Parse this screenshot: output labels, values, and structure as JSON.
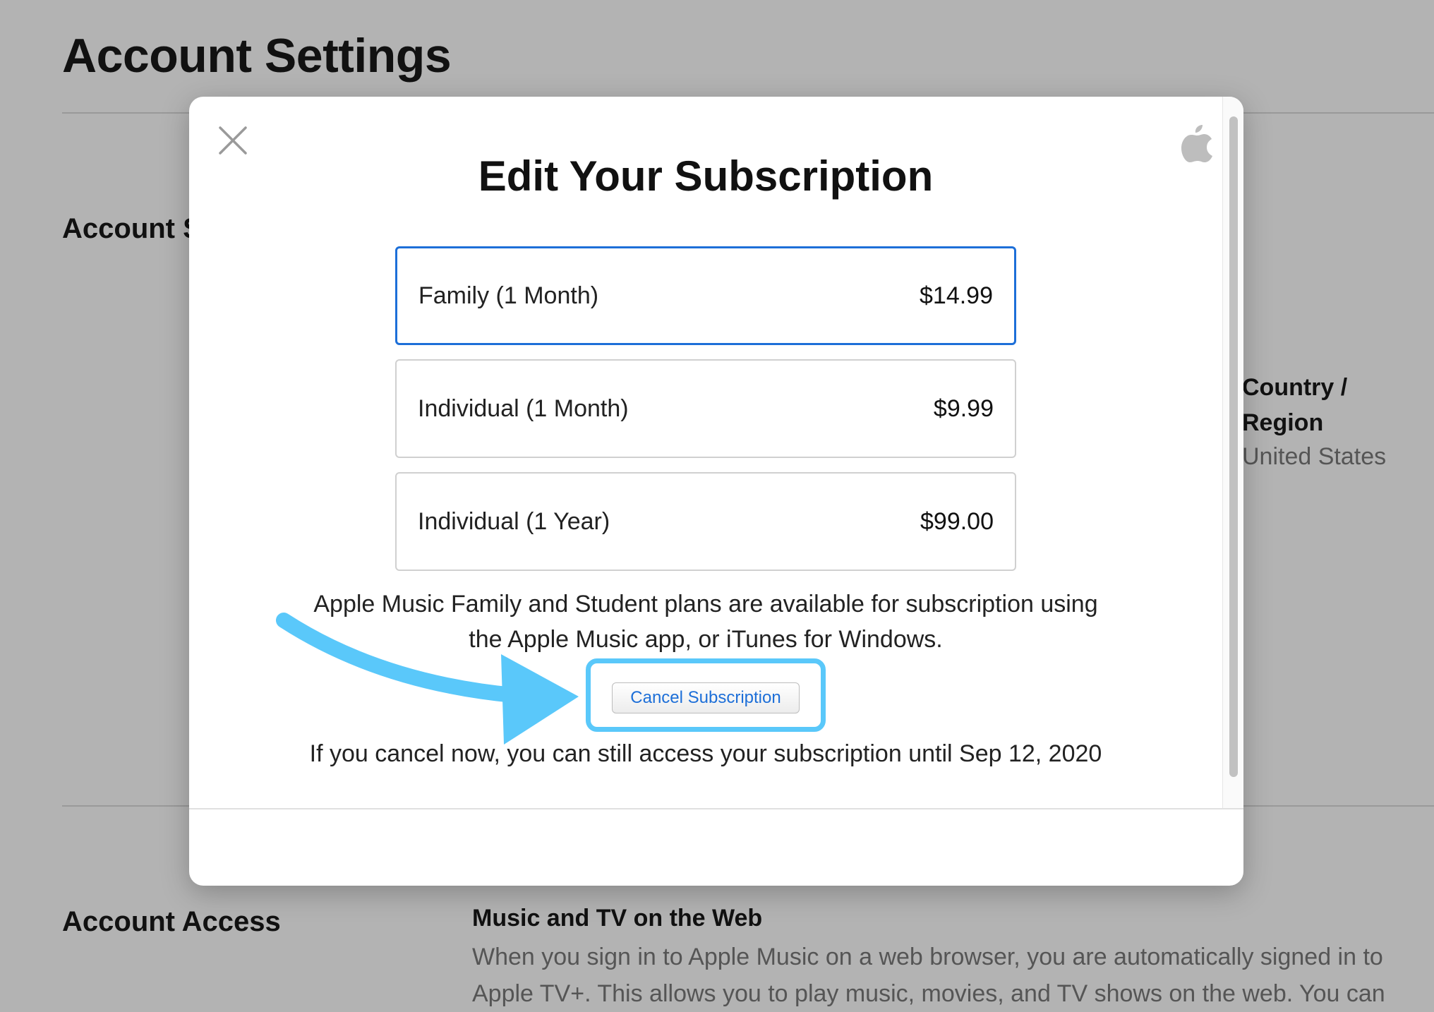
{
  "background": {
    "page_title": "Account Settings",
    "account_summary_label": "Account S",
    "country_region_label": "Country / Region",
    "country_region_value": "United States",
    "account_access_label": "Account Access",
    "music_tv_web_title": "Music and TV on the Web",
    "music_tv_web_text": "When you sign in to Apple Music on a web browser, you are automatically signed in to Apple TV+. This allows you to play music, movies, and TV shows on the web. You can"
  },
  "modal": {
    "close_icon": "close-icon",
    "logo_icon": "apple-logo-icon",
    "title": "Edit Your Subscription",
    "plans": [
      {
        "name": "Family (1 Month)",
        "price": "$14.99",
        "selected": true
      },
      {
        "name": "Individual (1 Month)",
        "price": "$9.99",
        "selected": false
      },
      {
        "name": "Individual (1 Year)",
        "price": "$99.00",
        "selected": false
      }
    ],
    "info_text": "Apple Music Family and Student plans are available for subscription using the Apple Music app, or iTunes for Windows.",
    "cancel_button_label": "Cancel Subscription",
    "cancel_note": "If you cancel now, you can still access your subscription until Sep 12, 2020"
  },
  "colors": {
    "accent": "#1d6fd8",
    "highlight": "#5ac8fa",
    "overlay": "#b3b3b3"
  }
}
